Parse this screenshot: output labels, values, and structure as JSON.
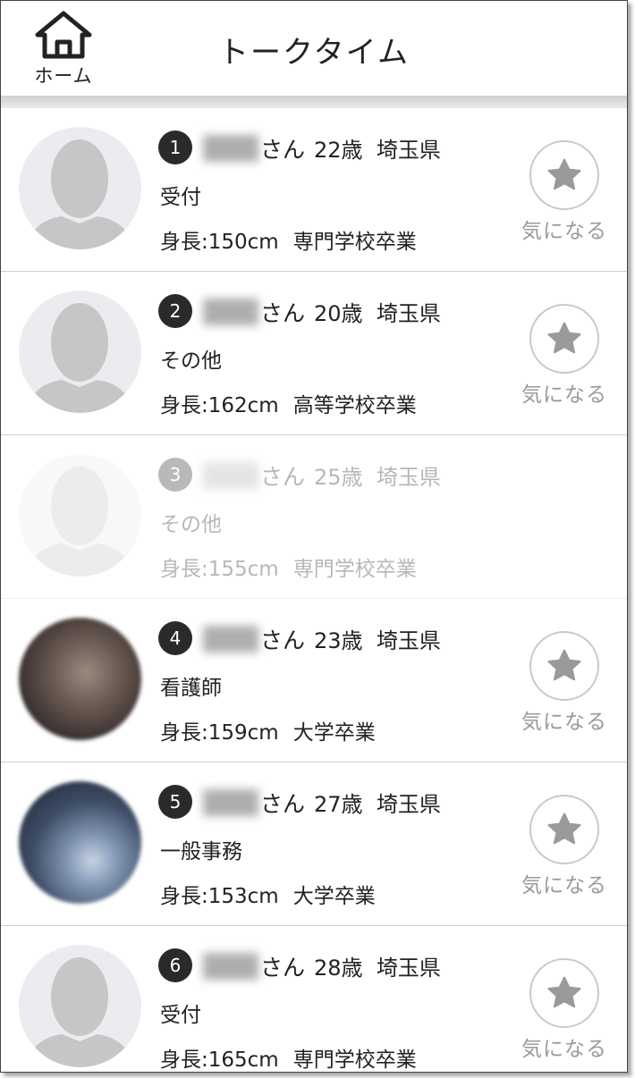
{
  "header": {
    "home_label": "ホーム",
    "title": "トークタイム"
  },
  "favorite_label": "気になる",
  "users": [
    {
      "number": "1",
      "honorific": "さん",
      "age": "22歳",
      "prefecture": "埼玉県",
      "job": "受付",
      "height": "身長:150cm",
      "education": "専門学校卒業",
      "avatar": "placeholder",
      "dimmed": false
    },
    {
      "number": "2",
      "honorific": "さん",
      "age": "20歳",
      "prefecture": "埼玉県",
      "job": "その他",
      "height": "身長:162cm",
      "education": "高等学校卒業",
      "avatar": "placeholder",
      "dimmed": false
    },
    {
      "number": "3",
      "honorific": "さん",
      "age": "25歳",
      "prefecture": "埼玉県",
      "job": "その他",
      "height": "身長:155cm",
      "education": "専門学校卒業",
      "avatar": "placeholder",
      "dimmed": true
    },
    {
      "number": "4",
      "honorific": "さん",
      "age": "23歳",
      "prefecture": "埼玉県",
      "job": "看護師",
      "height": "身長:159cm",
      "education": "大学卒業",
      "avatar": "photo",
      "dimmed": false
    },
    {
      "number": "5",
      "honorific": "さん",
      "age": "27歳",
      "prefecture": "埼玉県",
      "job": "一般事務",
      "height": "身長:153cm",
      "education": "大学卒業",
      "avatar": "photo",
      "dimmed": false
    },
    {
      "number": "6",
      "honorific": "さん",
      "age": "28歳",
      "prefecture": "埼玉県",
      "job": "受付",
      "height": "身長:165cm",
      "education": "専門学校卒業",
      "avatar": "placeholder",
      "dimmed": false
    }
  ]
}
